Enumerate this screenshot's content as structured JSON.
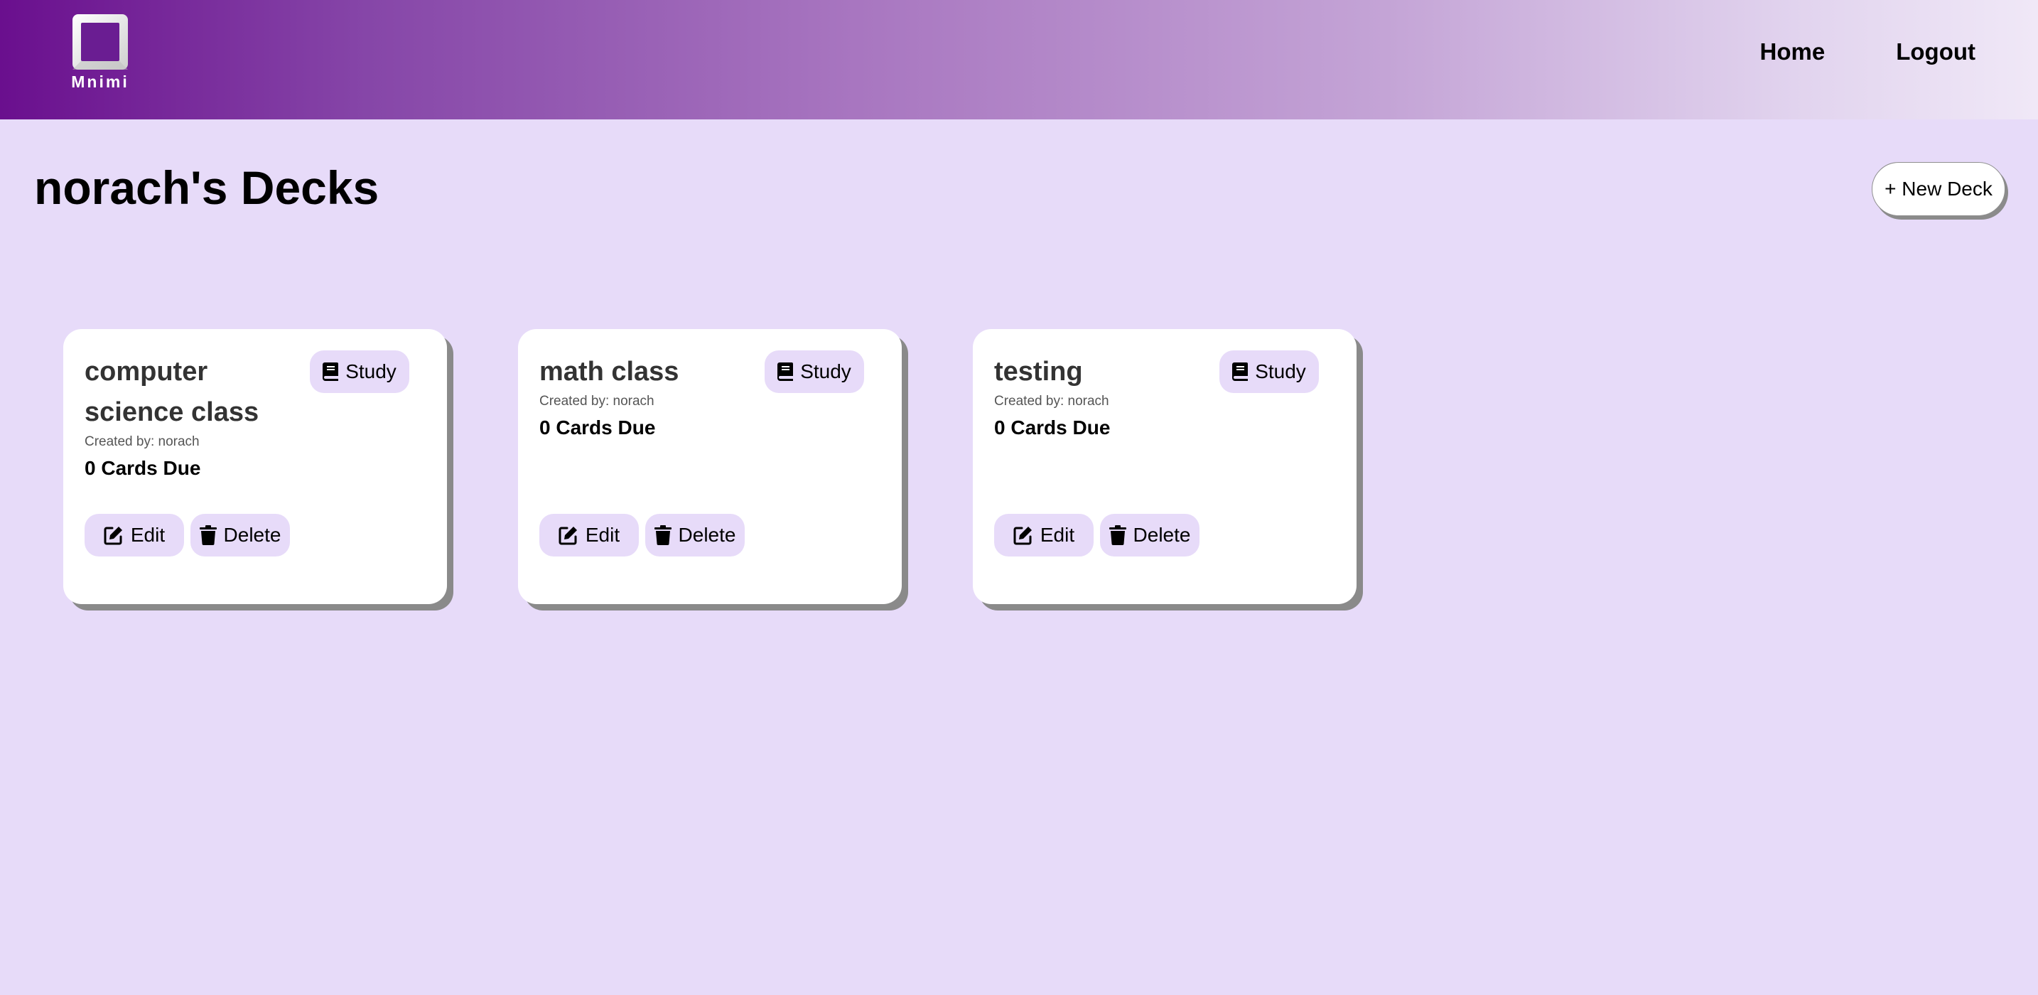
{
  "header": {
    "brand_name": "Mnimi",
    "nav": {
      "home_label": "Home",
      "logout_label": "Logout"
    }
  },
  "page": {
    "title": "norach's Decks",
    "new_deck_label": "+ New Deck"
  },
  "decks": [
    {
      "title": "computer science class",
      "created_by": "Created by: norach",
      "cards_due": "0 Cards Due",
      "study_label": "Study",
      "edit_label": "Edit",
      "delete_label": "Delete"
    },
    {
      "title": "math class",
      "created_by": "Created by: norach",
      "cards_due": "0 Cards Due",
      "study_label": "Study",
      "edit_label": "Edit",
      "delete_label": "Delete"
    },
    {
      "title": "testing",
      "created_by": "Created by: norach",
      "cards_due": "0 Cards Due",
      "study_label": "Study",
      "edit_label": "Edit",
      "delete_label": "Delete"
    }
  ],
  "icons": {
    "study": "book-icon",
    "edit": "edit-icon",
    "delete": "trash-icon",
    "logo": "square-logo-icon"
  },
  "colors": {
    "page_background": "#e7dbf9",
    "header_gradient_start": "#6a0f8e",
    "header_gradient_end": "#f0e8f7",
    "button_background": "#e7dbf9",
    "card_background": "#ffffff",
    "card_shadow": "#8a8a8a"
  }
}
